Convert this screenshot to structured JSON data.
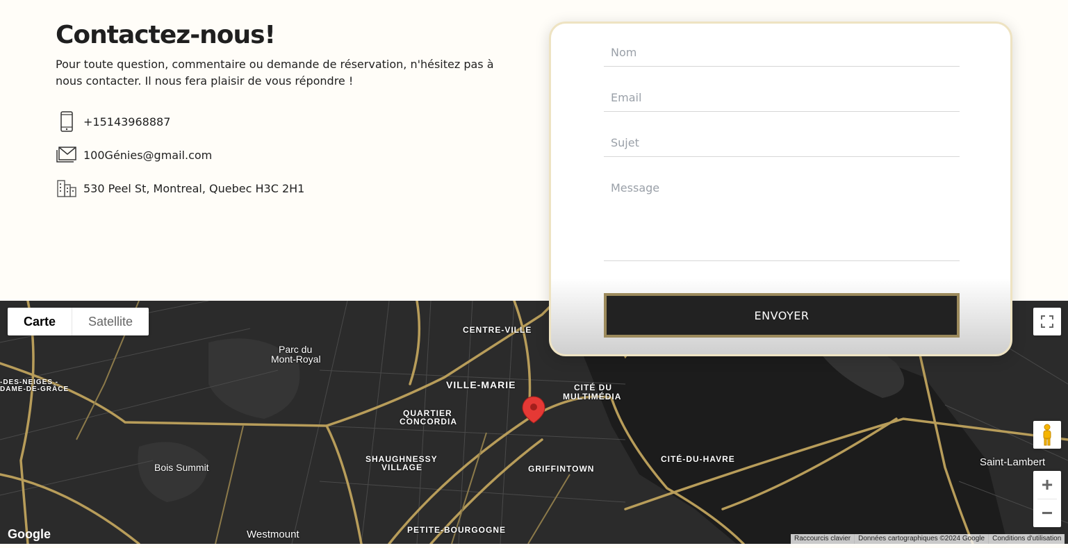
{
  "contact": {
    "title": "Contactez-nous!",
    "intro": "Pour toute question, commentaire ou demande de réservation, n'hésitez pas à nous contacter. Il nous fera plaisir de vous répondre !",
    "items": [
      {
        "icon": "phone-icon",
        "text": "+15143968887"
      },
      {
        "icon": "mail-icon",
        "text": "100Génies@gmail.com"
      },
      {
        "icon": "building-icon",
        "text": "530 Peel St, Montreal, Quebec H3C 2H1"
      }
    ]
  },
  "form": {
    "name_placeholder": "Nom",
    "email_placeholder": "Email",
    "subject_placeholder": "Sujet",
    "message_placeholder": "Message",
    "submit_label": "ENVOYER"
  },
  "map": {
    "type_map": "Carte",
    "type_satellite": "Satellite",
    "zoom_in": "+",
    "zoom_out": "−",
    "logo": "Google",
    "attribution": {
      "shortcuts": "Raccourcis clavier",
      "data": "Données cartographiques ©2024 Google",
      "terms": "Conditions d'utilisation"
    },
    "labels": {
      "centre_ville": "CENTRE-VILLE",
      "parc1": "Parc du",
      "parc2": "Mont-Royal",
      "ville_marie": "VILLE-MARIE",
      "cite_multimedia1": "CITÉ DU",
      "cite_multimedia2": "MULTIMÉDIA",
      "quartier1": "QUARTIER",
      "quartier2": "CONCORDIA",
      "shaughnessy1": "SHAUGHNESSY",
      "shaughnessy2": "VILLAGE",
      "griffintown": "GRIFFINTOWN",
      "cite_havre": "CITÉ-DU-HAVRE",
      "saint_lambert": "Saint-Lambert",
      "bois_summit": "Bois Summit",
      "westmount": "Westmount",
      "petite_bourgogne": "PETITE-BOURGOGNE",
      "cdn1": "-DES-NEIGES -",
      "cdn2": "DAME-DE-GRÂCE"
    },
    "colors": {
      "road": "#b89d5a",
      "ground": "#2a2a2a",
      "water": "#1a1a1a",
      "pin": "#e53935"
    }
  }
}
